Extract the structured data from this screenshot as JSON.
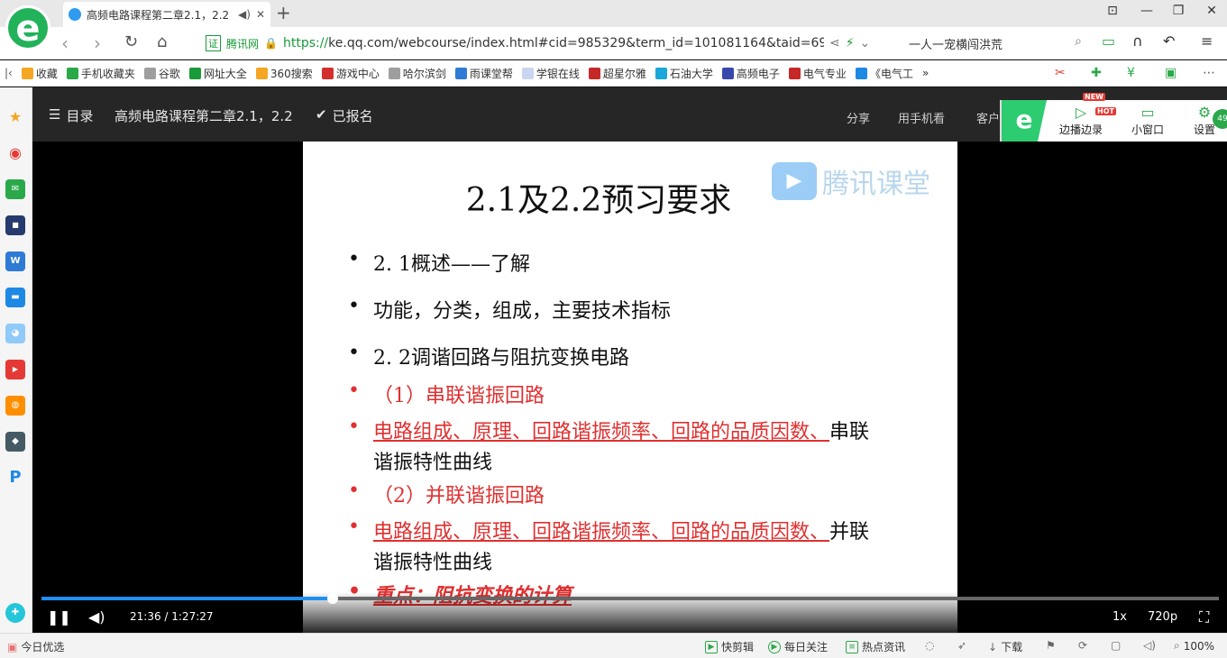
{
  "browser": {
    "tab": {
      "title": "高频电路课程第二章2.1，2.2",
      "mute_icon": "speaker-icon",
      "close": "✕"
    },
    "new_tab": "+",
    "window": {
      "minimize": "—",
      "restore": "❐",
      "close": "✕",
      "pin": "⊡"
    },
    "address": {
      "cert_badge": "证",
      "cert_name": "腾讯网",
      "url_scheme": "https://",
      "url_rest": "ke.qq.com/webcourse/index.html#cid=985329&term_id=101081164&taid=692777"
    },
    "search": {
      "value": "一人一宠横闯洪荒"
    },
    "bookmarks": [
      {
        "label": "收藏",
        "color": "#f5a623"
      },
      {
        "label": "手机收藏夹",
        "color": "#2ba84a"
      },
      {
        "label": "谷歌",
        "color": "#9e9e9e"
      },
      {
        "label": "网址大全",
        "color": "#1b9a3a"
      },
      {
        "label": "360搜索",
        "color": "#f5a623"
      },
      {
        "label": "游戏中心",
        "color": "#d32f2f"
      },
      {
        "label": "哈尔滨剑",
        "color": "#9e9e9e"
      },
      {
        "label": "雨课堂帮",
        "color": "#2e7bd6"
      },
      {
        "label": "学银在线",
        "color": "#c9d6f0"
      },
      {
        "label": "超星尔雅",
        "color": "#c62828"
      },
      {
        "label": "石油大学",
        "color": "#19a8d8"
      },
      {
        "label": "高频电子",
        "color": "#3949ab"
      },
      {
        "label": "电气专业",
        "color": "#c62828"
      },
      {
        "label": "《电气工",
        "color": "#1e88e5"
      }
    ],
    "bookmarks_more": "»"
  },
  "course": {
    "menu_label": "目录",
    "title": "高频电路课程第二章2.1，2.2",
    "enrolled": "已报名",
    "share": "分享",
    "mobile": "用手机看",
    "client": "客户",
    "tools": [
      {
        "label": "边播边录",
        "icon": "record-icon",
        "badge": "HOT",
        "badge_new": "NEW"
      },
      {
        "label": "小窗口",
        "icon": "tv-icon"
      },
      {
        "label": "设置",
        "icon": "gear-icon"
      }
    ],
    "tools_counter": "49"
  },
  "slide": {
    "title": "2.1及2.2预习要求",
    "watermark": "腾讯课堂",
    "bullets": [
      {
        "dot": "•",
        "text": "2. 1概述——了解"
      },
      {
        "dot": "•",
        "text": "功能，分类，组成，主要技术指标"
      },
      {
        "dot": "•",
        "text": "2. 2调谐回路与阻抗变换电路"
      },
      {
        "dot": "•",
        "text": "（1）串联谐振回路"
      },
      {
        "dot": "•",
        "red": "电路组成、原理、回路谐振频率、回路的品质因数、",
        "black": "串联",
        "line2": "谐振特性曲线"
      },
      {
        "dot": "•",
        "text": "（2）并联谐振回路"
      },
      {
        "dot": "•",
        "red": "电路组成、原理、回路谐振频率、回路的品质因数、",
        "black": "并联",
        "line2": "谐振特性曲线"
      },
      {
        "dot": "•",
        "text": "重点：阻抗变换的计算"
      }
    ]
  },
  "player": {
    "time": "21:36 / 1:27:27",
    "progress": 0.247,
    "speed": "1x",
    "quality": "720p"
  },
  "status": {
    "left": "今日优选",
    "items": [
      "快剪辑",
      "每日关注",
      "热点资讯",
      "下载"
    ],
    "zoom": "100%"
  }
}
